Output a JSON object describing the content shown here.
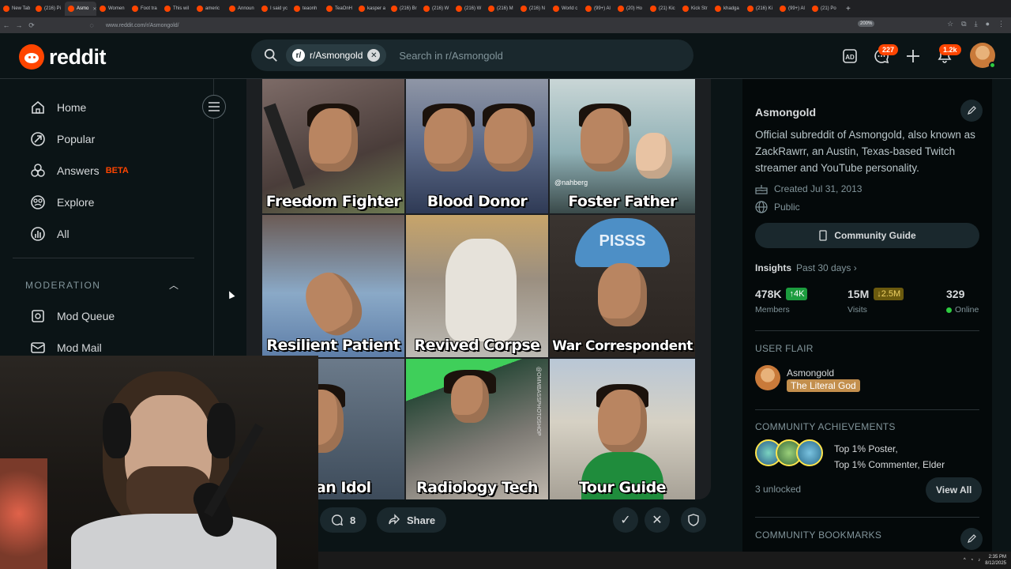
{
  "browser": {
    "tabs": [
      {
        "label": "New Tab",
        "active": false
      },
      {
        "label": "(216) Pi",
        "active": false
      },
      {
        "label": "Asmo",
        "active": true
      },
      {
        "label": "Women",
        "active": false
      },
      {
        "label": "Foot tra",
        "active": false
      },
      {
        "label": "This wil",
        "active": false
      },
      {
        "label": "americ",
        "active": false
      },
      {
        "label": "Announ",
        "active": false
      },
      {
        "label": "I said yc",
        "active": false
      },
      {
        "label": "teaonh",
        "active": false
      },
      {
        "label": "TeaOnH",
        "active": false
      },
      {
        "label": "kasper a",
        "active": false
      },
      {
        "label": "(216) Br",
        "active": false
      },
      {
        "label": "(216) W",
        "active": false
      },
      {
        "label": "(216) W",
        "active": false
      },
      {
        "label": "(216) M",
        "active": false
      },
      {
        "label": "(216) N",
        "active": false
      },
      {
        "label": "World c",
        "active": false
      },
      {
        "label": "(99+) Al",
        "active": false
      },
      {
        "label": "(20) Ho",
        "active": false
      },
      {
        "label": "(21) Kic",
        "active": false
      },
      {
        "label": "Kick Str",
        "active": false
      },
      {
        "label": "khadga",
        "active": false
      },
      {
        "label": "(216) Ki",
        "active": false
      },
      {
        "label": "(99+) Al",
        "active": false
      },
      {
        "label": "(21) Po",
        "active": false
      }
    ],
    "url": "www.reddit.com/r/Asmongold/",
    "zoom": "200%"
  },
  "header": {
    "logo_text": "reddit",
    "search_chip": "r/Asmongold",
    "search_placeholder": "Search in r/Asmongold",
    "chat_badge": "227",
    "notif_badge": "1.2k"
  },
  "leftnav": {
    "items": [
      {
        "label": "Home",
        "icon": "home-icon"
      },
      {
        "label": "Popular",
        "icon": "popular-icon"
      },
      {
        "label": "Answers",
        "icon": "answers-icon",
        "tag": "BETA"
      },
      {
        "label": "Explore",
        "icon": "explore-icon"
      },
      {
        "label": "All",
        "icon": "all-icon"
      }
    ],
    "moderation_heading": "MODERATION",
    "mod_items": [
      {
        "label": "Mod Queue",
        "icon": "mod-queue-icon"
      },
      {
        "label": "Mod Mail",
        "icon": "mod-mail-icon"
      }
    ]
  },
  "post": {
    "captions": [
      "Freedom Fighter",
      "Blood Donor",
      "Foster Father",
      "Resilient Patient",
      "Revived Corpse",
      "War Correspondent",
      "rican Idol",
      "Radiology Tech",
      "Tour Guide"
    ],
    "helmet_text": "PISSS",
    "watermark": "@nahberg",
    "side_watermark": "@OMMBASSPHOTOSHOP",
    "comments": "8",
    "share": "Share"
  },
  "sidebar": {
    "name": "Asmongold",
    "description": "Official subreddit of Asmongold, also known as ZackRawrr, an Austin, Texas-based Twitch streamer and YouTube personality.",
    "created": "Created Jul 31, 2013",
    "visibility": "Public",
    "guide_button": "Community Guide",
    "insights_label": "Insights",
    "insights_period": "Past 30 days",
    "stats": [
      {
        "value": "478K",
        "change": "4K",
        "direction": "up",
        "label": "Members"
      },
      {
        "value": "15M",
        "change": "2.5M",
        "direction": "down",
        "label": "Visits"
      },
      {
        "value": "329",
        "change": "",
        "direction": "",
        "label": "Online"
      }
    ],
    "user_flair_heading": "USER FLAIR",
    "flair_user": "Asmongold",
    "flair_tag": "The Literal God",
    "achievements_heading": "COMMUNITY ACHIEVEMENTS",
    "achievements_line1": "Top 1% Poster,",
    "achievements_line2": "Top 1% Commenter, Elder",
    "unlocked": "3 unlocked",
    "view_all": "View All",
    "bookmarks_heading": "COMMUNITY BOOKMARKS"
  },
  "taskbar": {
    "time": "2:35 PM",
    "date": "8/12/2025"
  }
}
